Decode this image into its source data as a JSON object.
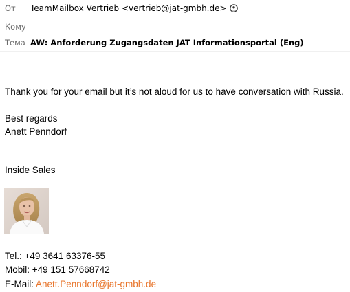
{
  "header": {
    "from_label": "От",
    "from_value": "TeamMailbox Vertrieb <vertrieb@jat-gmbh.de>",
    "from_icon": "contact-card-icon",
    "to_label": "Кому",
    "to_value": "",
    "subject_label": "Тема",
    "subject_value": "AW: Anforderung Zugangsdaten JAT Informationsportal (Eng)"
  },
  "body": {
    "message": "Thank you for your email but it’s  not aloud for us  to have conversation with Russia.",
    "greeting": "Best regards",
    "sender_name": "Anett Penndorf",
    "department": "Inside Sales",
    "photo_icon": "portrait-photo",
    "tel_label": "Tel.: ",
    "tel_value": "+49 3641 63376-55",
    "mobil_label": "Mobil: ",
    "mobil_value": "+49 151 57668742",
    "email_label": "E-Mail: ",
    "email_value": "Anett.Penndorf@jat-gmbh.de"
  },
  "colors": {
    "link": "#e8742a",
    "label": "#6b6b6b"
  }
}
